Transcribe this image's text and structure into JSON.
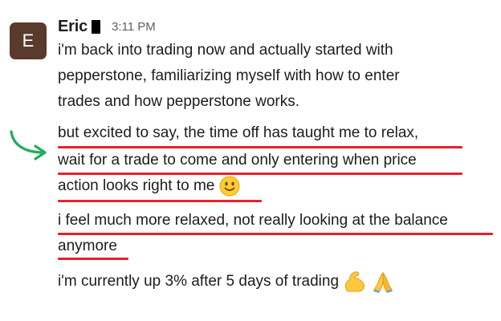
{
  "message": {
    "avatar_initial": "E",
    "sender": "Eric",
    "timestamp": "3:11 PM",
    "lines": [
      "i'm back into trading now and actually started with",
      "pepperstone, familiarizing myself with how to enter",
      "trades and how pepperstone works.",
      "but excited to say, the time off has taught me to relax,",
      "wait for a trade to come and only entering when price",
      "action looks right to me",
      "i feel much more relaxed, not really looking at the balance",
      "anymore",
      "i'm currently up 3% after 5 days of trading"
    ]
  },
  "icons": {
    "arrow": "curved-arrow-icon",
    "smile": "slightly-smiling-face-emoji",
    "muscle": "flexed-biceps-emoji",
    "pray": "folded-hands-emoji"
  },
  "colors": {
    "avatar_bg": "#5a3a2c",
    "underline": "#e5212b",
    "arrow": "#1fae5b"
  }
}
